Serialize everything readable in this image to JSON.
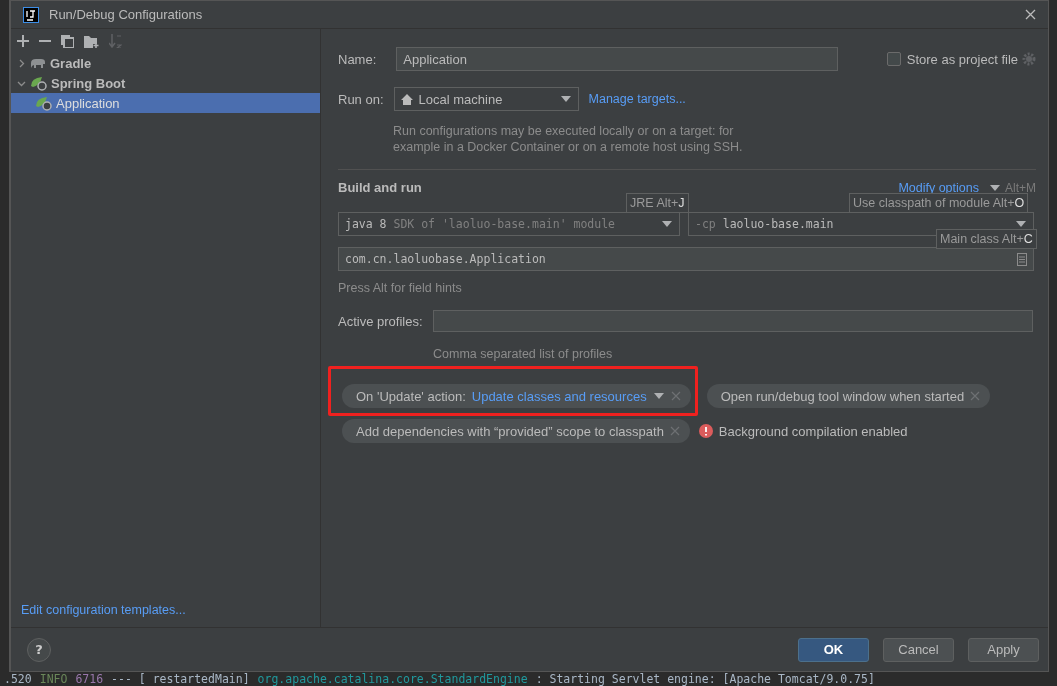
{
  "window": {
    "title": "Run/Debug Configurations"
  },
  "toolbar": [
    {
      "kind": "add",
      "disabled": false
    },
    {
      "kind": "remove",
      "disabled": false
    },
    {
      "kind": "copy",
      "disabled": false
    },
    {
      "kind": "folder",
      "disabled": false
    },
    {
      "kind": "sort",
      "disabled": true
    }
  ],
  "tree": [
    {
      "label": "Gradle",
      "kind": "gradle",
      "expanded": false,
      "selected": false
    },
    {
      "label": "Spring Boot",
      "kind": "spring",
      "expanded": true,
      "selected": false,
      "children": [
        {
          "label": "Application",
          "kind": "spring",
          "selected": true
        }
      ]
    }
  ],
  "help_button": "?",
  "templates_link": "Edit configuration templates...",
  "form": {
    "name_label": "Name:",
    "name_value": "Application",
    "store_label": "Store as project file",
    "store_checked": false,
    "run_on_label": "Run on:",
    "run_on_value": "Local machine",
    "manage_link": "Manage targets...",
    "run_on_hint": "Run configurations may be executed locally or on a target: for example in a Docker Container or on a remote host using SSH.",
    "section_title": "Build and run",
    "modify_link": "Modify options",
    "modify_shortcut": "Alt+M",
    "jre": {
      "main": "java 8",
      "rest": "SDK of 'laoluo-base.main' module"
    },
    "classpath": {
      "flag": "-cp",
      "value": "laoluo-base.main"
    },
    "main_class": "com.cn.laoluobase.Application",
    "field_hint": "Press Alt for field hints",
    "profiles_label": "Active profiles:",
    "profiles_hint": "Comma separated list of profiles",
    "tooltips": [
      {
        "text": "JRE Alt+",
        "key": "J"
      },
      {
        "text": "Use classpath of module Alt+",
        "key": "O"
      },
      {
        "text": "Main class Alt+",
        "key": "C"
      }
    ],
    "chips": [
      {
        "label": "On 'Update' action:",
        "value": "Update classes and resources",
        "highlighted": true
      },
      {
        "label": "Open run/debug tool window when started",
        "highlighted": false
      },
      {
        "label": "Add dependencies with “provided” scope to classpath",
        "highlighted": false
      }
    ],
    "warning": "Background compilation enabled"
  },
  "buttons": [
    {
      "label": "OK",
      "default": true
    },
    {
      "label": "Cancel",
      "default": false
    },
    {
      "label": "Apply",
      "default": false
    }
  ],
  "log_line": [
    {
      "text": ".520",
      "kind": "plain"
    },
    {
      "text": "INFO",
      "kind": "info"
    },
    {
      "text": "6716",
      "kind": "pid"
    },
    {
      "text": "--- [  restartedMain]",
      "kind": "plain"
    },
    {
      "text": "org.apache.catalina.core.StandardEngine",
      "kind": "logger"
    },
    {
      "text": ": Starting Servlet engine: [Apache Tomcat/9.0.75]",
      "kind": "plain"
    }
  ]
}
